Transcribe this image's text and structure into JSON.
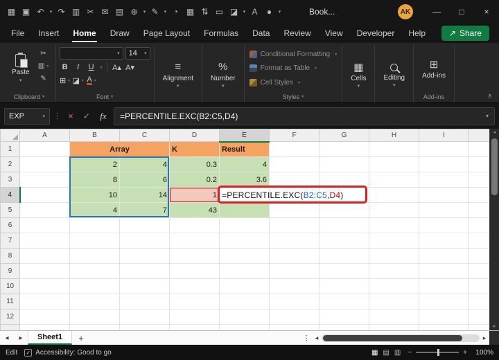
{
  "colors": {
    "accent_green": "#107C41",
    "header_orange": "#F4A460",
    "cell_green": "#C6E0B4",
    "reference_blue": "#2E75B6",
    "reference_red": "#C00000",
    "annotation_red": "#E21B1B"
  },
  "titlebar": {
    "title": "Book...",
    "avatar_initials": "AK"
  },
  "icons": {
    "app_menu": "▦",
    "save": "▣",
    "undo": "↶",
    "redo": "↷",
    "copy": "▥",
    "cut": "✂",
    "mail": "✉",
    "picture": "▤",
    "globe": "⊕",
    "pen": "✎",
    "clock": "◔",
    "table": "▦",
    "sort": "⇅",
    "print": "▭",
    "chart": "◪",
    "font_tool": "A",
    "record": "●",
    "caret_down": "▾",
    "caret_up": "∧",
    "minimize": "—",
    "maximize": "□",
    "close": "×",
    "dots": "⋮",
    "cancel": "×",
    "enter": "✓",
    "share": "↗",
    "align": "≡",
    "percent": "%",
    "bold": "B",
    "italic": "I",
    "underline": "U",
    "borders": "⊞",
    "fill": "◪",
    "font_color": "A",
    "grow_font": "A▴",
    "shrink_font": "A▾",
    "addins": "⊞",
    "prev": "◂",
    "next": "▸",
    "plus": "+",
    "minus": "−",
    "check": "✓",
    "view_normal": "▦",
    "view_layout": "▤",
    "view_break": "▥"
  },
  "menu": {
    "tabs": [
      "File",
      "Insert",
      "Home",
      "Draw",
      "Page Layout",
      "Formulas",
      "Data",
      "Review",
      "View",
      "Developer",
      "Help"
    ],
    "share_label": "Share"
  },
  "ribbon": {
    "paste_label": "Paste",
    "font_name": "",
    "font_size": "14",
    "alignment_label": "Alignment",
    "number_label": "Number",
    "cells_label": "Cells",
    "editing_label": "Editing",
    "addins_label": "Add-ins",
    "styles_items": [
      "Conditional Formatting",
      "Format as Table",
      "Cell Styles"
    ],
    "group_labels": {
      "clipboard": "Clipboard",
      "font": "Font",
      "styles": "Styles",
      "addins": "Add-ins"
    }
  },
  "formula_bar": {
    "name_box": "EXP",
    "fx_label": "fx",
    "formula": "=PERCENTILE.EXC(B2:C5,D4)"
  },
  "grid": {
    "columns": [
      "A",
      "B",
      "C",
      "D",
      "E",
      "F",
      "G",
      "H",
      "I"
    ],
    "rows": [
      "1",
      "2",
      "3",
      "4",
      "5",
      "6",
      "7",
      "8",
      "9",
      "10",
      "11",
      "12"
    ],
    "selected_cell": "E4"
  },
  "cells": {
    "array_header": "Array",
    "k_header": "K",
    "result_header": "Result",
    "b2": "2",
    "c2": "4",
    "d2": "0.3",
    "e2": "4",
    "b3": "8",
    "c3": "6",
    "d3": "0.2",
    "e3": "3.6",
    "b4": "10",
    "c4": "14",
    "d4": "1",
    "b5": "4",
    "c5": "7",
    "d5": "43"
  },
  "cell_formula": {
    "p1": "=PERCENTILE.EXC(",
    "ref1": "B2:C5",
    "sep": ",",
    "ref2": "D4",
    "p3": ")"
  },
  "sheet_bar": {
    "sheet_name": "Sheet1"
  },
  "status_bar": {
    "mode": "Edit",
    "accessibility": "Accessibility: Good to go",
    "zoom_level": "100%"
  }
}
